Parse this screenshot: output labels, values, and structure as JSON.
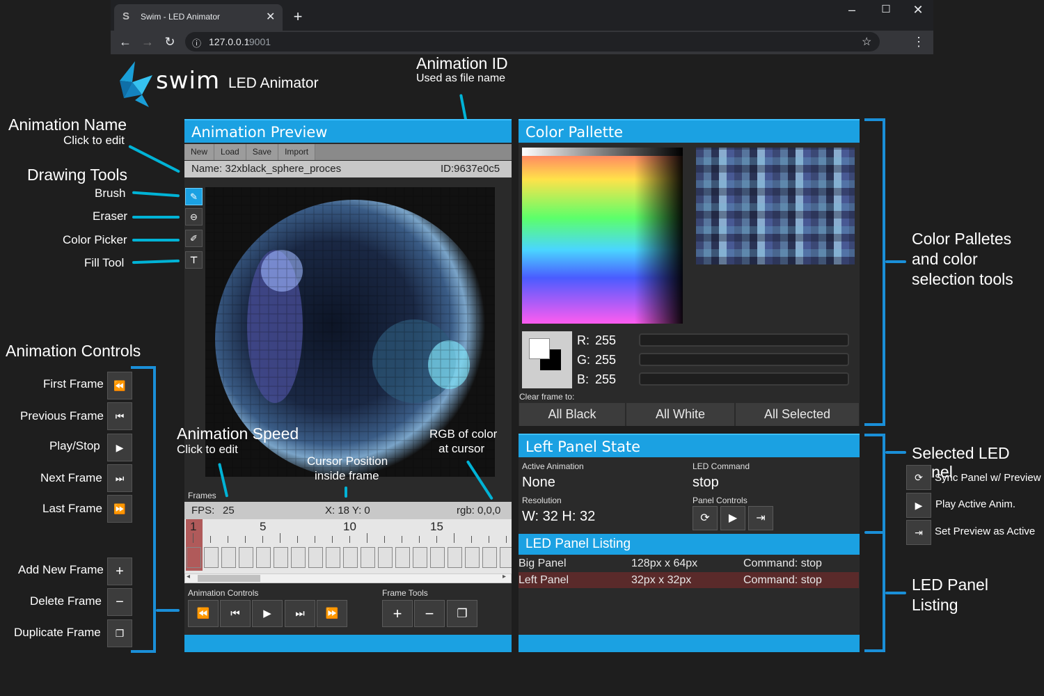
{
  "browser": {
    "tab_title": "Swim - LED Animator",
    "url_host": "127.0.0.1",
    "url_port": ":9001"
  },
  "app": {
    "logo_text": "swim",
    "subtitle": "LED Animator"
  },
  "annotations": {
    "animation_id": "Animation ID",
    "animation_id_sub": "Used as file name",
    "animation_name": "Animation Name",
    "animation_name_sub": "Click to edit",
    "drawing_tools": "Drawing Tools",
    "brush": "Brush",
    "eraser": "Eraser",
    "color_picker": "Color Picker",
    "fill_tool": "Fill Tool",
    "animation_controls": "Animation Controls",
    "first_frame": "First Frame",
    "previous_frame": "Previous Frame",
    "play_stop": "Play/Stop",
    "next_frame": "Next Frame",
    "last_frame": "Last Frame",
    "add_new_frame": "Add New Frame",
    "delete_frame": "Delete Frame",
    "duplicate_frame": "Duplicate Frame",
    "animation_speed": "Animation Speed",
    "animation_speed_sub": "Click to edit",
    "cursor_position_1": "Cursor Position",
    "cursor_position_2": "inside frame",
    "rgb_cursor_1": "RGB of color",
    "rgb_cursor_2": "at cursor",
    "color_palletes_1": "Color Palletes",
    "color_palletes_2": "and color",
    "color_palletes_3": "selection tools",
    "selected_led_panel": "Selected LED Panel",
    "sync_panel": "Sync Panel w/ Preview",
    "play_active": "Play Active Anim.",
    "set_preview": "Set Preview as Active",
    "led_panel_listing_1": "LED Panel",
    "led_panel_listing_2": "Listing"
  },
  "preview": {
    "title": "Animation Preview",
    "menu": [
      "New",
      "Load",
      "Save",
      "Import"
    ],
    "name_label": "Name: 32xblack_sphere_proces",
    "id_label": "ID:9637e0c5",
    "frames_label": "Frames",
    "fps_label": "FPS:",
    "fps_value": "25",
    "cursor_pos": "X: 18 Y: 0",
    "rgb": "rgb: 0,0,0",
    "timeline_ticks": [
      "1",
      "5",
      "10",
      "15"
    ],
    "controls_label": "Animation Controls",
    "frame_tools_label": "Frame Tools"
  },
  "palette": {
    "title": "Color Pallette",
    "r_label": "R:",
    "r_value": "255",
    "g_label": "G:",
    "g_value": "255",
    "b_label": "B:",
    "b_value": "255",
    "clear_label": "Clear frame to:",
    "clear_buttons": [
      "All Black",
      "All White",
      "All Selected"
    ]
  },
  "panel_state": {
    "title": "Left Panel State",
    "active_anim_label": "Active Animation",
    "active_anim_value": "None",
    "led_command_label": "LED Command",
    "led_command_value": "stop",
    "resolution_label": "Resolution",
    "resolution_value": "W: 32 H: 32",
    "panel_controls_label": "Panel Controls"
  },
  "listing": {
    "title": "LED Panel Listing",
    "rows": [
      {
        "name": "Big Panel",
        "size": "128px x 64px",
        "command": "Command: stop"
      },
      {
        "name": "Left Panel",
        "size": "32px x 32px",
        "command": "Command: stop"
      }
    ]
  },
  "colors": {
    "accent": "#1ba1e2",
    "annotation_line": "#00b3d6",
    "bracket": "#1a8fd8",
    "selected_row": "#5a2a2a"
  }
}
